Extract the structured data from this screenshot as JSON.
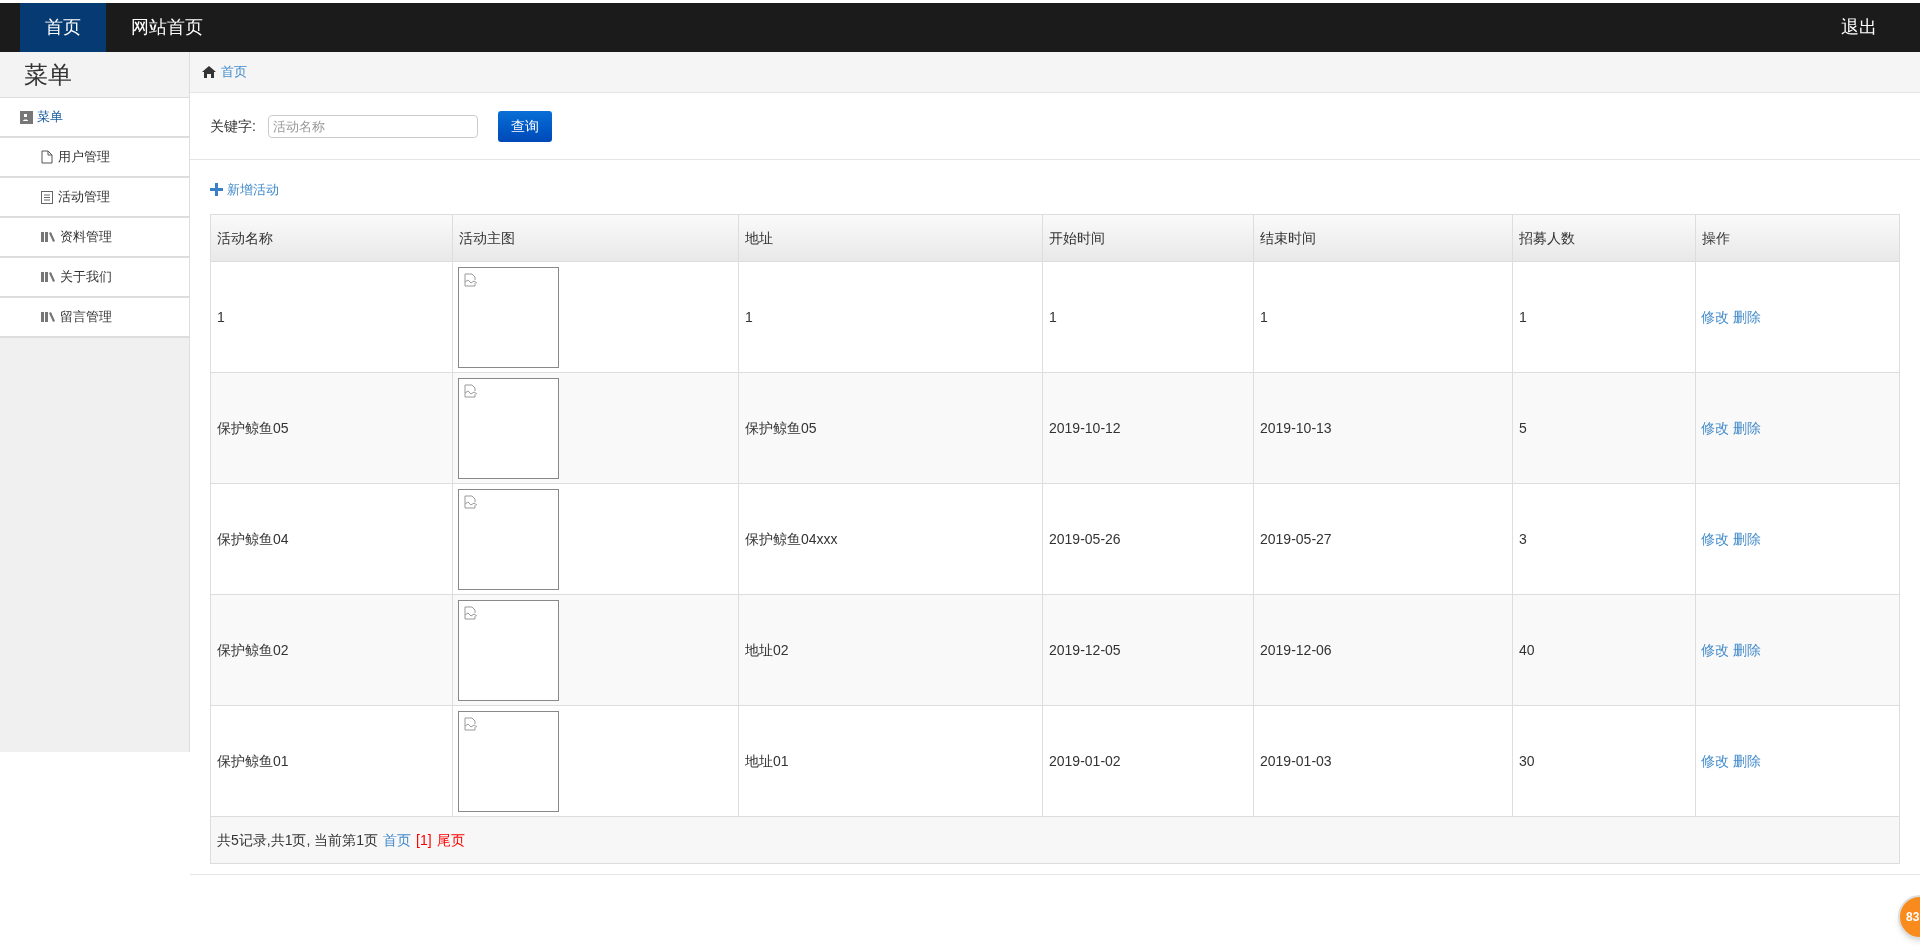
{
  "top_nav": {
    "tabs": [
      {
        "label": "首页",
        "selected": true
      },
      {
        "label": "网站首页",
        "selected": false
      }
    ],
    "logout": "退出"
  },
  "sidebar": {
    "title": "菜单",
    "section": "菜单",
    "items": [
      {
        "label": "用户管理"
      },
      {
        "label": "活动管理"
      },
      {
        "label": "资料管理"
      },
      {
        "label": "关于我们"
      },
      {
        "label": "留言管理"
      }
    ]
  },
  "breadcrumb": "首页",
  "search": {
    "label": "关键字:",
    "placeholder": "活动名称",
    "button": "查询"
  },
  "add_link": "新增活动",
  "table": {
    "columns": [
      "活动名称",
      "活动主图",
      "地址",
      "开始时间",
      "结束时间",
      "招募人数",
      "操作"
    ],
    "rows": [
      {
        "name": "1",
        "image": {
          "kind": "picture"
        },
        "address": "1",
        "start": "1",
        "end": "1",
        "count": "1",
        "actions": [
          "修改",
          "删除"
        ]
      },
      {
        "name": "保护鲸鱼05",
        "image": {
          "kind": "picture"
        },
        "address": "保护鲸鱼05",
        "start": "2019-10-12",
        "end": "2019-10-13",
        "count": "5",
        "actions": [
          "修改",
          "删除"
        ]
      },
      {
        "name": "保护鲸鱼04",
        "image": {
          "kind": "picture"
        },
        "address": "保护鲸鱼04xxx",
        "start": "2019-05-26",
        "end": "2019-05-27",
        "count": "3",
        "actions": [
          "修改",
          "删除"
        ]
      },
      {
        "name": "保护鲸鱼02",
        "image": {
          "kind": "picture"
        },
        "address": "地址02",
        "start": "2019-12-05",
        "end": "2019-12-06",
        "count": "40",
        "actions": [
          "修改",
          "删除"
        ]
      },
      {
        "name": "保护鲸鱼01",
        "image": {
          "kind": "picture"
        },
        "address": "地址01",
        "start": "2019-01-02",
        "end": "2019-01-03",
        "count": "30",
        "actions": [
          "修改",
          "删除"
        ]
      }
    ]
  },
  "pagination": {
    "summary": "共5记录,共1页, 当前第1页",
    "links": [
      {
        "label": "首页",
        "color": "#428bca"
      },
      {
        "label": "[1]",
        "color": "#ff0000"
      },
      {
        "label": "尾页",
        "color": "#ff0000"
      }
    ]
  },
  "badge": "83"
}
